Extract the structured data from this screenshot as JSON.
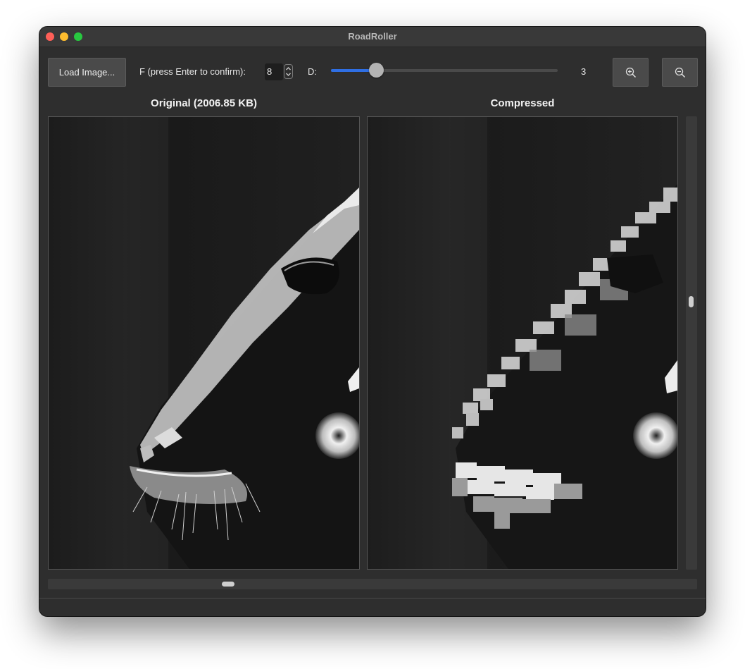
{
  "window": {
    "title": "RoadRoller"
  },
  "toolbar": {
    "load_label": "Load Image...",
    "f_label": "F (press Enter to confirm):",
    "f_value": "8",
    "d_label": "D:",
    "d_value": "3",
    "d_slider_fraction": 0.2,
    "zoom_in_icon": "zoom-in-icon",
    "zoom_out_icon": "zoom-out-icon"
  },
  "panels": {
    "original_title": "Original (2006.85 KB)",
    "compressed_title": "Compressed"
  },
  "colors": {
    "accent": "#2f6fe4",
    "window_bg": "#2e2e2e",
    "button_bg": "#4a4a4a"
  }
}
